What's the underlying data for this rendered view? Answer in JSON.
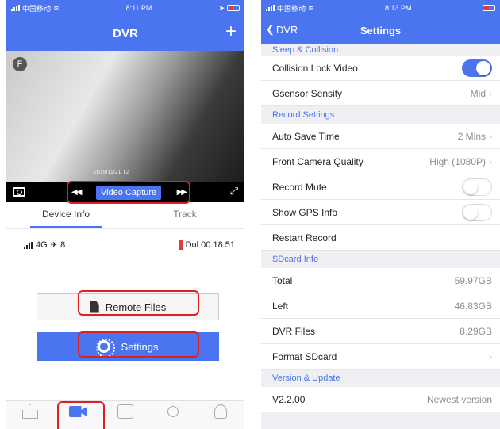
{
  "left_phone": {
    "status_bar": {
      "carrier": "中国移动",
      "time": "8:11 PM"
    },
    "title": "DVR",
    "plus": "+",
    "camera_badge": "F",
    "video_timestamp": "2019/11/21 T2",
    "video_controls": {
      "rewind": "◀◀",
      "capture_label": "Video Capture",
      "forward": "▶▶",
      "expand": "⤢"
    },
    "tabs": [
      {
        "label": "Device Info",
        "active": true
      },
      {
        "label": "Track",
        "active": false
      }
    ],
    "device_status": {
      "network": "4G",
      "gps_count": "8",
      "recording": "Dul 00:18:51"
    },
    "buttons": {
      "remote_files": "Remote Files",
      "settings": "Settings"
    },
    "accent_color": "#4a74f0",
    "highlight_color": "#e02020"
  },
  "right_phone": {
    "status_bar": {
      "carrier": "中国移动",
      "time": "8:13 PM"
    },
    "back_label": "DVR",
    "title": "Settings",
    "sections": [
      {
        "header": "Sleep & Collision",
        "rows": [
          {
            "label": "Collision Lock Video",
            "toggle": true
          },
          {
            "label": "Gsensor Sensity",
            "value": "Mid",
            "chevron": true
          }
        ]
      },
      {
        "header": "Record Settings",
        "rows": [
          {
            "label": "Auto Save Time",
            "value": "2 Mins",
            "chevron": true
          },
          {
            "label": "Front Camera Quality",
            "value": "High (1080P)",
            "chevron": true
          },
          {
            "label": "Record Mute",
            "toggle": false
          },
          {
            "label": "Show GPS Info",
            "toggle": false
          },
          {
            "label": "Restart Record"
          }
        ]
      },
      {
        "header": "SDcard Info",
        "rows": [
          {
            "label": "Total",
            "value": "59.97GB"
          },
          {
            "label": "Left",
            "value": "46.83GB"
          },
          {
            "label": "DVR Files",
            "value": "8.29GB"
          },
          {
            "label": "Format SDcard",
            "chevron": true
          }
        ]
      },
      {
        "header": "Version & Update",
        "rows": [
          {
            "label": "V2.2.00",
            "value": "Newest version"
          }
        ]
      }
    ]
  }
}
